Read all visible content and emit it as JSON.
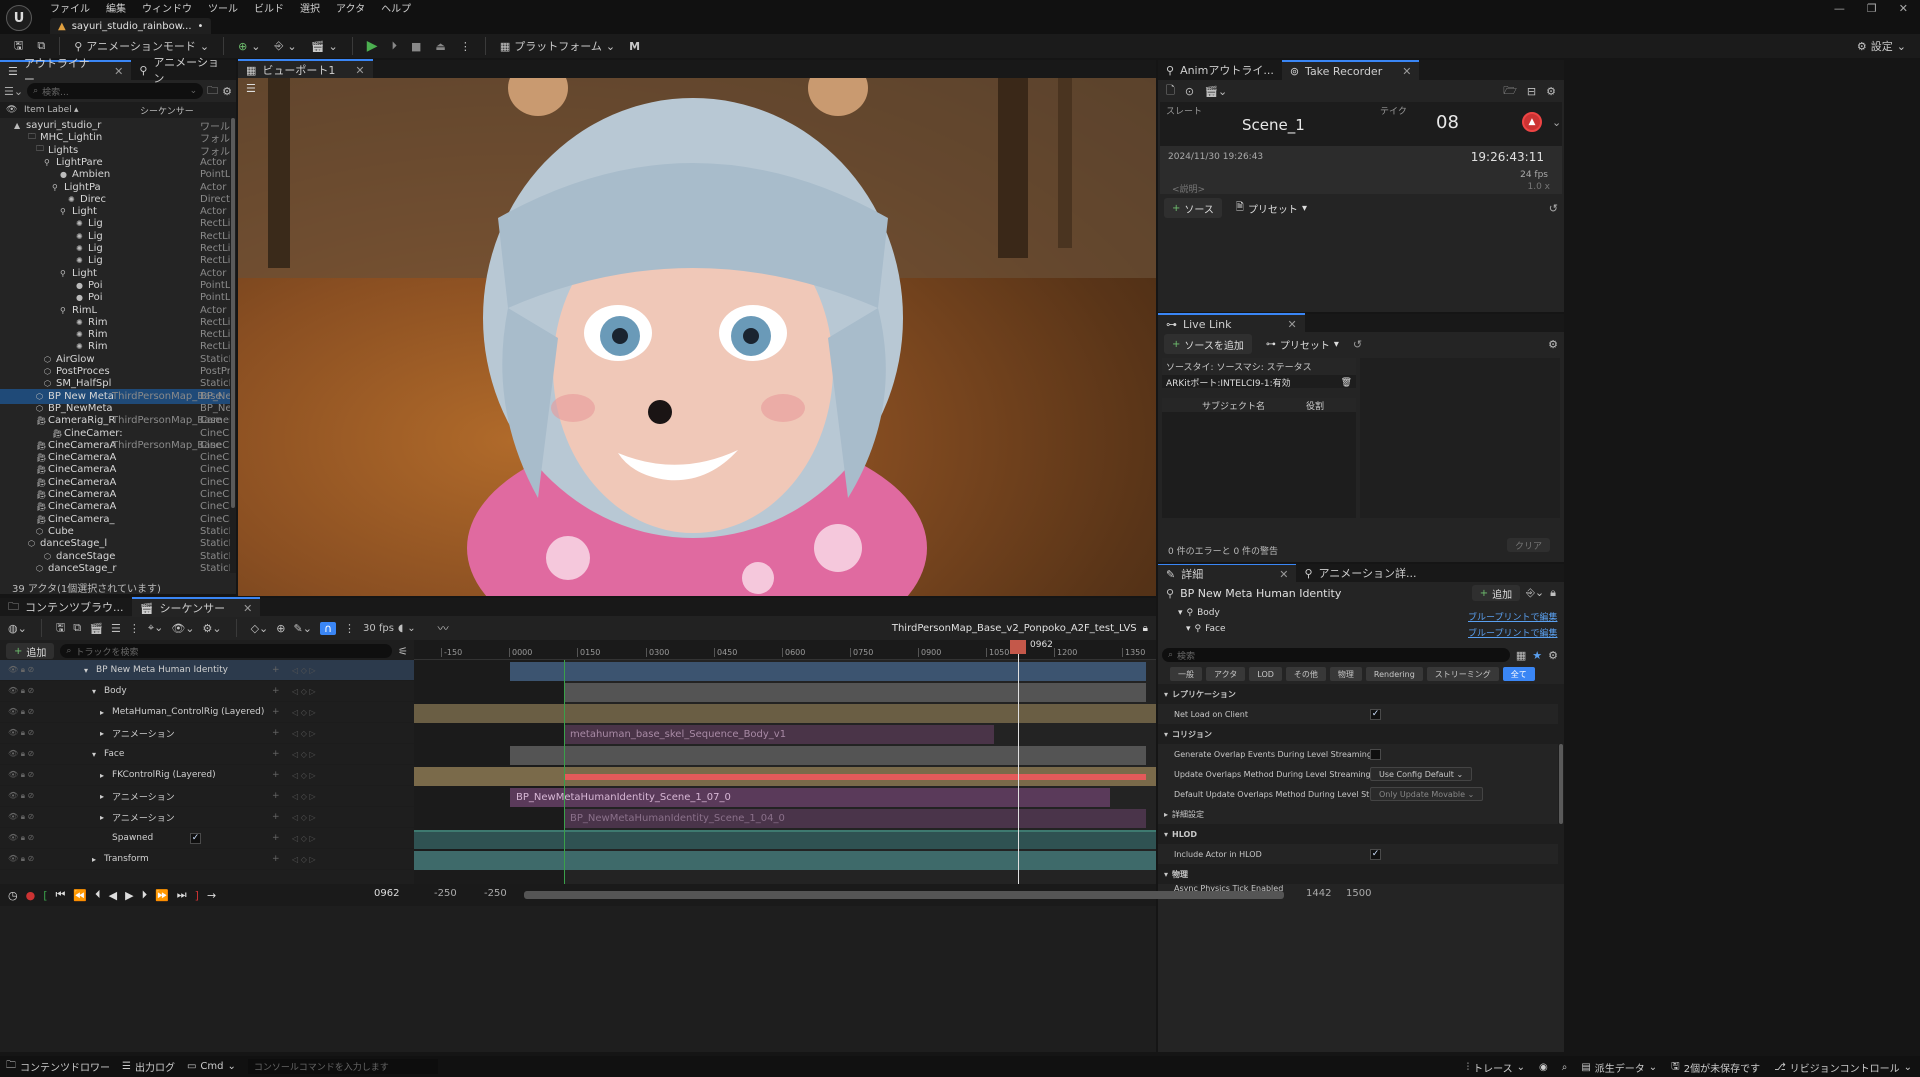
{
  "menu": {
    "items": [
      "ファイル",
      "編集",
      "ウィンドウ",
      "ツール",
      "ビルド",
      "選択",
      "アクタ",
      "ヘルプ"
    ],
    "project_tab": "sayuri_studio_rainbow...",
    "modified_marker": "•"
  },
  "window": {
    "controls": [
      "minimize-icon",
      "restore-icon",
      "close-icon"
    ]
  },
  "toolbar": {
    "mode": "アニメーションモード",
    "platform": "プラットフォーム",
    "settings": "設定"
  },
  "outliner": {
    "tab": "アウトライナー",
    "tab2": "アニメーション",
    "search_placeholder": "検索...",
    "col_label": "Item Label",
    "col_sequencer": "シーケンサー",
    "col_type": "タイプ",
    "rows": [
      {
        "label": "sayuri_studio_r",
        "seq": "",
        "type": "ワール",
        "indent": 26,
        "icon": "map",
        "sel": false
      },
      {
        "label": "MHC_Lightin",
        "seq": "",
        "type": "フォルダ",
        "indent": 40,
        "icon": "folder",
        "sel": false
      },
      {
        "label": "Lights",
        "seq": "",
        "type": "フォルダ",
        "indent": 48,
        "icon": "folder",
        "sel": false
      },
      {
        "label": "LightPare",
        "seq": "",
        "type": "Actor",
        "indent": 56,
        "icon": "actor",
        "sel": false
      },
      {
        "label": "Ambien",
        "seq": "",
        "type": "PointLi",
        "indent": 72,
        "icon": "bulb",
        "sel": false
      },
      {
        "label": "LightPa",
        "seq": "",
        "type": "Actor",
        "indent": 64,
        "icon": "actor",
        "sel": false
      },
      {
        "label": "Direc",
        "seq": "",
        "type": "Directio",
        "indent": 80,
        "icon": "sun",
        "sel": false
      },
      {
        "label": "Light",
        "seq": "",
        "type": "Actor",
        "indent": 72,
        "icon": "actor",
        "sel": false
      },
      {
        "label": "Lig",
        "seq": "",
        "type": "RectLig",
        "indent": 88,
        "icon": "sun",
        "sel": false
      },
      {
        "label": "Lig",
        "seq": "",
        "type": "RectLig",
        "indent": 88,
        "icon": "sun",
        "sel": false
      },
      {
        "label": "Lig",
        "seq": "",
        "type": "RectLig",
        "indent": 88,
        "icon": "sun",
        "sel": false
      },
      {
        "label": "Lig",
        "seq": "",
        "type": "RectLig",
        "indent": 88,
        "icon": "sun",
        "sel": false
      },
      {
        "label": "Light",
        "seq": "",
        "type": "Actor",
        "indent": 72,
        "icon": "actor",
        "sel": false
      },
      {
        "label": "Poi",
        "seq": "",
        "type": "PointLi",
        "indent": 88,
        "icon": "bulb",
        "sel": false
      },
      {
        "label": "Poi",
        "seq": "",
        "type": "PointLi",
        "indent": 88,
        "icon": "bulb",
        "sel": false
      },
      {
        "label": "RimL",
        "seq": "",
        "type": "Actor",
        "indent": 72,
        "icon": "actor",
        "sel": false
      },
      {
        "label": "Rim",
        "seq": "",
        "type": "RectLig",
        "indent": 88,
        "icon": "sun",
        "sel": false
      },
      {
        "label": "Rim",
        "seq": "",
        "type": "RectLig",
        "indent": 88,
        "icon": "sun",
        "sel": false
      },
      {
        "label": "Rim",
        "seq": "",
        "type": "RectLig",
        "indent": 88,
        "icon": "sun",
        "sel": false
      },
      {
        "label": "AirGlow",
        "seq": "",
        "type": "StaticM",
        "indent": 56,
        "icon": "mesh",
        "sel": false
      },
      {
        "label": "PostProces",
        "seq": "",
        "type": "PostPrc",
        "indent": 56,
        "icon": "mesh",
        "sel": false
      },
      {
        "label": "SM_HalfSpl",
        "seq": "",
        "type": "StaticM",
        "indent": 56,
        "icon": "mesh",
        "sel": false
      },
      {
        "label": "BP New Meta",
        "seq": "ThirdPersonMap_Base",
        "type": "BP_Nev",
        "indent": 48,
        "icon": "mesh",
        "sel": true
      },
      {
        "label": "BP_NewMeta",
        "seq": "",
        "type": "BP_Nev",
        "indent": 48,
        "icon": "mesh",
        "sel": false
      },
      {
        "label": "CameraRig_R",
        "seq": "ThirdPersonMap_Base",
        "type": "Camera",
        "indent": 48,
        "icon": "camera",
        "sel": false
      },
      {
        "label": "CineCamer:",
        "seq": "",
        "type": "CineCar",
        "indent": 64,
        "icon": "camera",
        "sel": false
      },
      {
        "label": "CineCameraA",
        "seq": "ThirdPersonMap_Base",
        "type": "CineCar",
        "indent": 48,
        "icon": "camera",
        "sel": false
      },
      {
        "label": "CineCameraA",
        "seq": "",
        "type": "CineCar",
        "indent": 48,
        "icon": "camera",
        "sel": false
      },
      {
        "label": "CineCameraA",
        "seq": "",
        "type": "CineCar",
        "indent": 48,
        "icon": "camera",
        "sel": false
      },
      {
        "label": "CineCameraA",
        "seq": "",
        "type": "CineCar",
        "indent": 48,
        "icon": "camera",
        "sel": false
      },
      {
        "label": "CineCameraA",
        "seq": "",
        "type": "CineCar",
        "indent": 48,
        "icon": "camera",
        "sel": false
      },
      {
        "label": "CineCameraA",
        "seq": "",
        "type": "CineCar",
        "indent": 48,
        "icon": "camera",
        "sel": false
      },
      {
        "label": "CineCamera_",
        "seq": "",
        "type": "CineCar",
        "indent": 48,
        "icon": "camera",
        "sel": false
      },
      {
        "label": "Cube",
        "seq": "",
        "type": "StaticM",
        "indent": 48,
        "icon": "mesh",
        "sel": false
      },
      {
        "label": "danceStage_l",
        "seq": "",
        "type": "StaticM",
        "indent": 40,
        "icon": "mesh",
        "sel": false
      },
      {
        "label": "danceStage",
        "seq": "",
        "type": "StaticM",
        "indent": 56,
        "icon": "mesh",
        "sel": false
      },
      {
        "label": "danceStage_r",
        "seq": "",
        "type": "StaticM",
        "indent": 48,
        "icon": "mesh",
        "sel": false
      }
    ],
    "status": "39 アクタ(1個選択されています)"
  },
  "viewport": {
    "tab": "ビューポート1"
  },
  "take_recorder": {
    "tab1": "Animアウトライ...",
    "tab2": "Take Recorder",
    "slate_label": "スレート",
    "take_label": "テイク",
    "slate": "Scene_1",
    "take": "08",
    "date": "2024/11/30 19:26:43",
    "timecode": "19:26:43:11",
    "fps": "24 fps",
    "desc_placeholder": "<説明>",
    "speed": "1.0 x",
    "source_btn": "ソース",
    "preset_btn": "プリセット"
  },
  "live_link": {
    "tab": "Live Link",
    "add_source": "ソースを追加",
    "preset": "プリセット",
    "headers": "ソースタイ: ソースマシ: ステータス",
    "source_row": "ARKitポート:INTELCI9-1:有効",
    "subject_header": "サブジェクト名",
    "role_header": "役割",
    "errors": "0 件のエラーと 0 件の警告",
    "clear": "クリア"
  },
  "details": {
    "tab1": "詳細",
    "tab2": "アニメーション詳...",
    "actor": "BP New Meta Human Identity",
    "add": "追加",
    "comp_body": "Body",
    "comp_face": "Face",
    "bp_edit": "ブループリントで編集",
    "search_placeholder": "検索",
    "filters": [
      "一般",
      "アクタ",
      "LOD",
      "その他",
      "物理",
      "Rendering",
      "ストリーミング",
      "全て"
    ],
    "sec_replication": "レプリケーション",
    "net_load": "Net Load on Client",
    "sec_collision": "コリジョン",
    "gen_overlap": "Generate Overlap Events During Level Streaming",
    "upd_overlap": "Update Overlaps Method During Level Streaming",
    "upd_overlap_val": "Use Config Default",
    "def_upd_overlap": "Default Update Overlaps Method During Level Streaming",
    "def_upd_overlap_val": "Only Update Movable",
    "sec_advanced": "詳細設定",
    "sec_hlod": "HLOD",
    "include_hlod": "Include Actor in HLOD",
    "sec_physics": "物理",
    "async_physics": "Async Physics Tick Enabled"
  },
  "sequencer": {
    "tab1": "コンテンツブラウ...",
    "tab2": "シーケンサー",
    "fps": "30 fps",
    "sequence_name": "ThirdPersonMap_Base_v2_Ponpoko_A2F_test_LVS",
    "add": "追加",
    "search_placeholder": "トラックを検索",
    "tracks": [
      {
        "label": "BP New Meta Human Identity",
        "indent": 22,
        "top": true
      },
      {
        "label": "Body",
        "indent": 30,
        "top": false
      },
      {
        "label": "MetaHuman_ControlRig (Layered)",
        "indent": 38,
        "top": false
      },
      {
        "label": "アニメーション",
        "indent": 38,
        "top": false
      },
      {
        "label": "Face",
        "indent": 30,
        "top": false
      },
      {
        "label": "FKControlRig (Layered)",
        "indent": 38,
        "top": false
      },
      {
        "label": "アニメーション",
        "indent": 38,
        "top": false
      },
      {
        "label": "アニメーション",
        "indent": 38,
        "top": false
      },
      {
        "label": "Spawned",
        "indent": 38,
        "top": false
      },
      {
        "label": "Transform",
        "indent": 30,
        "top": false
      }
    ],
    "ruler_ticks": [
      "-150",
      "0000",
      "0150",
      "0300",
      "0450",
      "0600",
      "0750",
      "0900",
      "1050",
      "1200",
      "1350"
    ],
    "playhead": "0962",
    "clip1": "metahuman_base_skel_Sequence_Body_v1",
    "clip2": "BP_NewMetaHumanIdentity_Scene_1_07_0",
    "clip3": "BP_NewMetaHumanIdentity_Scene_1_04_0",
    "current_frame": "0962",
    "range_start": "-250",
    "range_start2": "-250",
    "range_end": "1442",
    "range_end2": "1500"
  },
  "statusbar": {
    "content_drawer": "コンテンツドロワー",
    "output_log": "出力ログ",
    "cmd": "Cmd",
    "cmd_placeholder": "コンソールコマンドを入力します",
    "trace": "トレース",
    "derived": "派生データ",
    "unsaved": "2個が未保存です",
    "revision": "リビジョンコントロール"
  },
  "colors": {
    "accent": "#3a86f5",
    "selection": "#1f4a78",
    "playhead": "#c4584a",
    "clip_purple": "#5a3a5a",
    "clip_tan": "#7a6a4a",
    "clip_teal": "#3e6a6a",
    "play_green": "#4caf50"
  }
}
